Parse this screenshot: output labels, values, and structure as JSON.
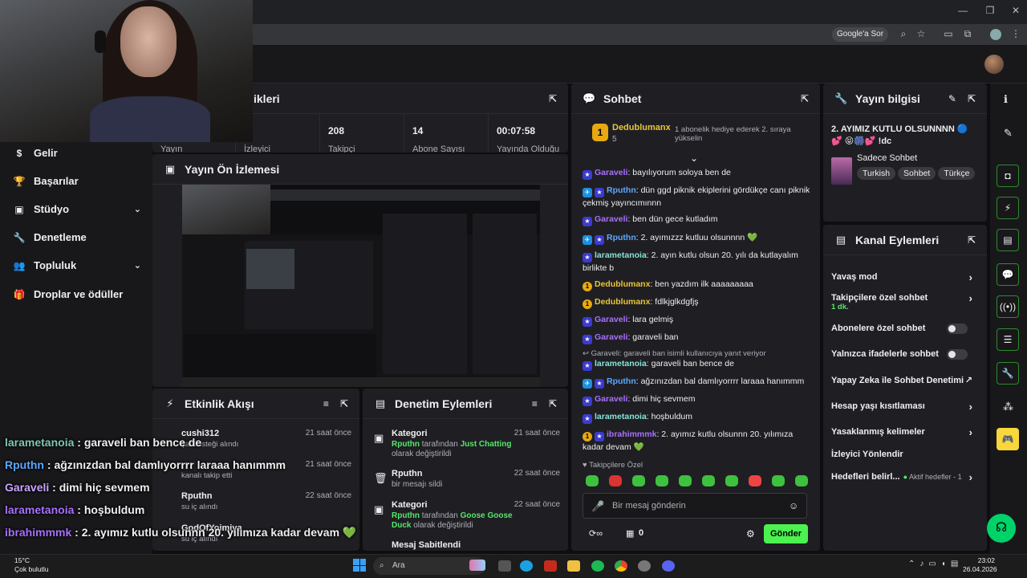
{
  "browser": {
    "google_btn": "Google'a Sor"
  },
  "sidebar": {
    "items": [
      {
        "label": "Gelir",
        "icon": "dollar-icon",
        "chevron": false
      },
      {
        "label": "Başarılar",
        "icon": "trophy-icon",
        "chevron": false
      },
      {
        "label": "Stüdyo",
        "icon": "studio-icon",
        "chevron": true
      },
      {
        "label": "Denetleme",
        "icon": "wrench-icon",
        "chevron": false
      },
      {
        "label": "Topluluk",
        "icon": "community-icon",
        "chevron": true
      },
      {
        "label": "Droplar ve ödüller",
        "icon": "drops-icon",
        "chevron": false
      }
    ]
  },
  "stats": {
    "title_partial": "ikleri",
    "items": [
      {
        "value": "",
        "label": "Yayın"
      },
      {
        "value": "",
        "label": "İzleyici"
      },
      {
        "value": "208",
        "label": "Takipçi"
      },
      {
        "value": "14",
        "label": "Abone Sayısı"
      },
      {
        "value": "00:07:58",
        "label": "Yayında Olduğu"
      }
    ]
  },
  "preview": {
    "title": "Yayın Ön İzlemesi"
  },
  "events": {
    "title": "Etkinlik Akışı",
    "items": [
      {
        "user": "cushi312",
        "time": "21 saat önce",
        "desc": "şarkı isteği alındı"
      },
      {
        "user": "",
        "time": "21 saat önce",
        "desc": "kanalı takip etti"
      },
      {
        "user": "Rputhn",
        "time": "22 saat önce",
        "desc": "su iç alındı"
      },
      {
        "user": "GodOfYoimiya",
        "time": "",
        "desc": "su iç alındı"
      }
    ]
  },
  "modevents": {
    "title": "Denetim Eylemleri",
    "items": [
      {
        "title": "Kategori",
        "time": "21 saat önce",
        "user": "Rputhn",
        "mid": " tarafından ",
        "cat": "Just Chatting",
        "end": " olarak değiştirildi"
      },
      {
        "title": "Rputhn",
        "time": "22 saat önce",
        "desc": "bir mesajı sildi"
      },
      {
        "title": "Kategori",
        "time": "22 saat önce",
        "user": "Rputhn",
        "mid": " tarafından ",
        "cat": "Goose Goose Duck",
        "end": " olarak değiştirildi"
      },
      {
        "title": "Mesaj Sabitlendi",
        "time": ""
      }
    ]
  },
  "chat": {
    "title": "Sohbet",
    "gifter": "Dedublumanx",
    "gifter_count": "5",
    "gift_text": "1 abonelik hediye ederek 2. sıraya yükselin",
    "messages": [
      {
        "badges": [
          "star"
        ],
        "user": "Garaveli",
        "color": "c-purple",
        "text": "bayılıyorum soloya ben de"
      },
      {
        "badges": [
          "prime",
          "star"
        ],
        "user": "Rputhn",
        "color": "c-blue",
        "text": "dün ggd piknik ekiplerini gördükçe canı piknik çekmiş yayıncımınnn"
      },
      {
        "badges": [
          "star"
        ],
        "user": "Garaveli",
        "color": "c-purple",
        "text": "ben dün gece kutladım"
      },
      {
        "badges": [
          "prime",
          "star"
        ],
        "user": "Rputhn",
        "color": "c-blue",
        "text": "2. ayımızzz kutluu olsunnnn 💚"
      },
      {
        "badges": [
          "star"
        ],
        "user": "larametanoia",
        "color": "c-teal",
        "text": "2. ayın kutlu olsun 20. yılı da kutlayalım birlikte b"
      },
      {
        "badges": [
          "gold"
        ],
        "user": "Dedublumanx",
        "color": "c-yellow",
        "text": "ben yazdım ilk aaaaaaaaa"
      },
      {
        "badges": [
          "gold"
        ],
        "user": "Dedublumanx",
        "color": "c-yellow",
        "text": "fdlkjglkdgfjş"
      },
      {
        "badges": [
          "star"
        ],
        "user": "Garaveli",
        "color": "c-purple",
        "text": "lara gelmiş"
      },
      {
        "badges": [
          "star"
        ],
        "user": "Garaveli",
        "color": "c-purple",
        "text": "garaveli ban"
      },
      {
        "badges": [],
        "user": "",
        "color": "",
        "text": "↩ Garaveli: garaveli ban isimli kullanıcıya yanıt veriyor"
      },
      {
        "badges": [
          "star"
        ],
        "user": "larametanoia",
        "color": "c-teal",
        "text": "garaveli ban bence de"
      },
      {
        "badges": [
          "prime",
          "star"
        ],
        "user": "Rputhn",
        "color": "c-blue",
        "text": "ağzınızdan bal damlıyorrrr laraaa hanımmm"
      },
      {
        "badges": [
          "star"
        ],
        "user": "Garaveli",
        "color": "c-purple",
        "text": "dimi hiç sevmem"
      },
      {
        "badges": [
          "star"
        ],
        "user": "larametanoia",
        "color": "c-teal",
        "text": "hoşbuldum"
      },
      {
        "badges": [
          "gold",
          "star"
        ],
        "user": "ibrahimmmk",
        "color": "c-purple",
        "text": "2. ayımız kutlu olsunnn 20. yılımıza kadar devam 💚"
      }
    ],
    "followers_only": "Takipçilere Özel",
    "placeholder": "Bir mesaj gönderin",
    "points": "0",
    "send": "Gönder"
  },
  "streaminfo": {
    "title": "Yayın bilgisi",
    "stream_title": "2. AYIMIZ KUTLU OLSUNNNN 🔵💕 😝🎆💕 !dc",
    "category": "Sadece Sohbet",
    "tags": [
      "Turkish",
      "Sohbet",
      "Türkçe"
    ]
  },
  "chanact": {
    "title": "Kanal Eylemleri",
    "items": [
      {
        "label": "Yavaş mod",
        "type": "chev",
        "sub": ""
      },
      {
        "label": "Takipçilere özel sohbet",
        "type": "chev",
        "sub": "1 dk."
      },
      {
        "label": "Abonelere özel sohbet",
        "type": "toggle",
        "sub": ""
      },
      {
        "label": "Yalnızca ifadelerle sohbet",
        "type": "toggle",
        "sub": ""
      },
      {
        "label": "Yapay Zeka ile Sohbet Denetimi",
        "type": "ext",
        "sub": ""
      },
      {
        "label": "Hesap yaşı kısıtlaması",
        "type": "chev",
        "sub": ""
      },
      {
        "label": "Yasaklanmış kelimeler",
        "type": "chev",
        "sub": ""
      },
      {
        "label": "İzleyici Yönlendir",
        "type": "none",
        "sub": ""
      },
      {
        "label": "Hedefleri belirl...",
        "type": "chev",
        "sub": "Aktif hedefler - 1"
      }
    ]
  },
  "overlay": [
    {
      "user": "larametanoia",
      "sep": " : ",
      "text": "garaveli ban bence de",
      "color": "#7fc7b0"
    },
    {
      "user": "Rputhn",
      "sep": " : ",
      "text": "ağzınızdan bal damlıyorrrr laraaa hanımmm",
      "color": "#5da7ff"
    },
    {
      "user": "Garaveli",
      "sep": " : ",
      "text": "dimi hiç sevmem",
      "color": "#c9a6ff"
    },
    {
      "user": "larametanoia",
      "sep": " : ",
      "text": "hoşbuldum",
      "color": "#a970ff"
    },
    {
      "user": "ibrahimmmk",
      "sep": " : ",
      "text": "2. ayımız kutlu olsunnn 20. yılımıza kadar devam 💚",
      "color": "#a970ff"
    }
  ],
  "taskbar": {
    "weather_temp": "15°C",
    "weather_desc": "Çok bulutlu",
    "search": "Ara",
    "time": "23:02",
    "date": "26.04.2026"
  }
}
